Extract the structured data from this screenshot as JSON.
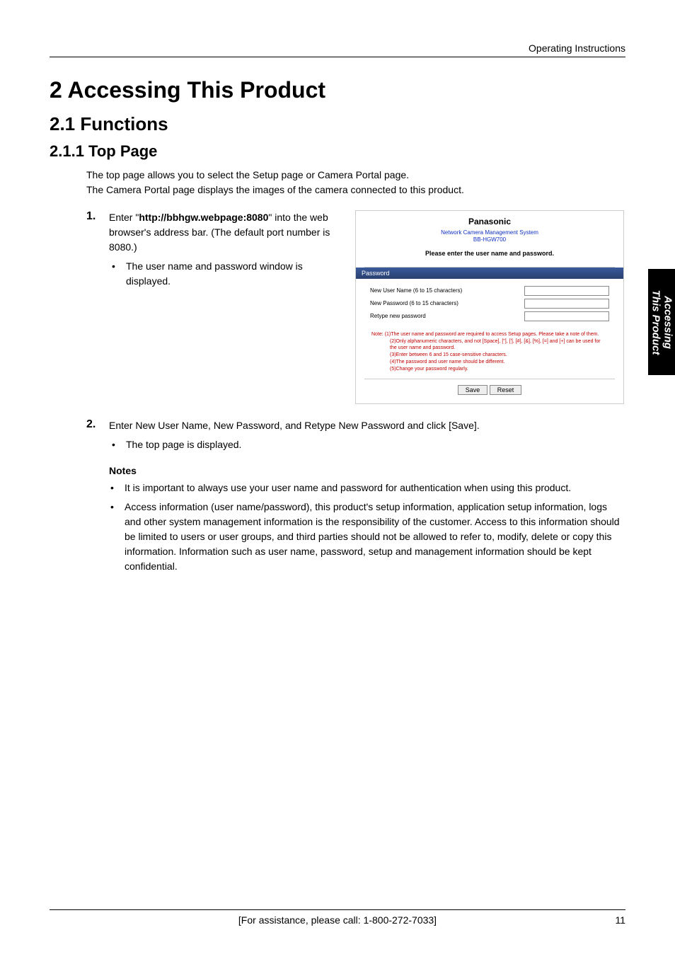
{
  "header": {
    "right": "Operating Instructions"
  },
  "sidebar": {
    "line1": "Accessing",
    "line2": "This Product"
  },
  "h1": "2      Accessing This Product",
  "h2": "2.1    Functions",
  "h3": "2.1.1    Top Page",
  "intro": "The top page allows you to select the Setup page or Camera Portal page.\nThe Camera Portal page displays the images of the camera connected to this product.",
  "steps": [
    {
      "num": "1.",
      "text_before": "Enter \"",
      "bold": "http://bbhgw.webpage:8080",
      "text_after": "\" into the web browser's address bar. (The default port number is 8080.)",
      "sub": [
        "The user name and password window is displayed."
      ]
    },
    {
      "num": "2.",
      "text": "Enter New User Name, New Password, and Retype New Password and click [Save].",
      "sub": [
        "The top page is displayed."
      ]
    }
  ],
  "shot": {
    "brand": "Panasonic",
    "link_line1": "Network Camera Management System",
    "link_line2": "BB-HGW700",
    "prompt": "Please enter the user name and password.",
    "pw_title": "Password",
    "fields": [
      {
        "label": "New User Name (6 to 15 characters)"
      },
      {
        "label": "New Password (6 to 15 characters)"
      },
      {
        "label": "Retype new password"
      }
    ],
    "note_label": "Note:",
    "notes": [
      "(1)The user name and password are required to access Setup pages. Please take a note of them.",
      "(2)Only alphanumeric characters, and not [Space], [\"], ['], [#], [&], [%], [=] and [+] can be used for the user name and password.",
      "(3)Enter between 6 and 15 case-sensitive characters.",
      "(4)The password and user name should be different.",
      "(5)Change your password regularly."
    ],
    "btn_save": "Save",
    "btn_reset": "Reset"
  },
  "notes_title": "Notes",
  "notes": [
    "It is important to always use your user name and password for authentication when using this product.",
    "Access information (user name/password), this product's setup information, application setup information, logs and other system management information is the responsibility of the customer. Access to this information should be limited to users or user groups, and third parties should not be allowed to refer to, modify, delete or copy this information. Information such as user name, password, setup and management information should be kept confidential."
  ],
  "footer": {
    "center": "[For assistance, please call: 1-800-272-7033]",
    "page": "11"
  }
}
